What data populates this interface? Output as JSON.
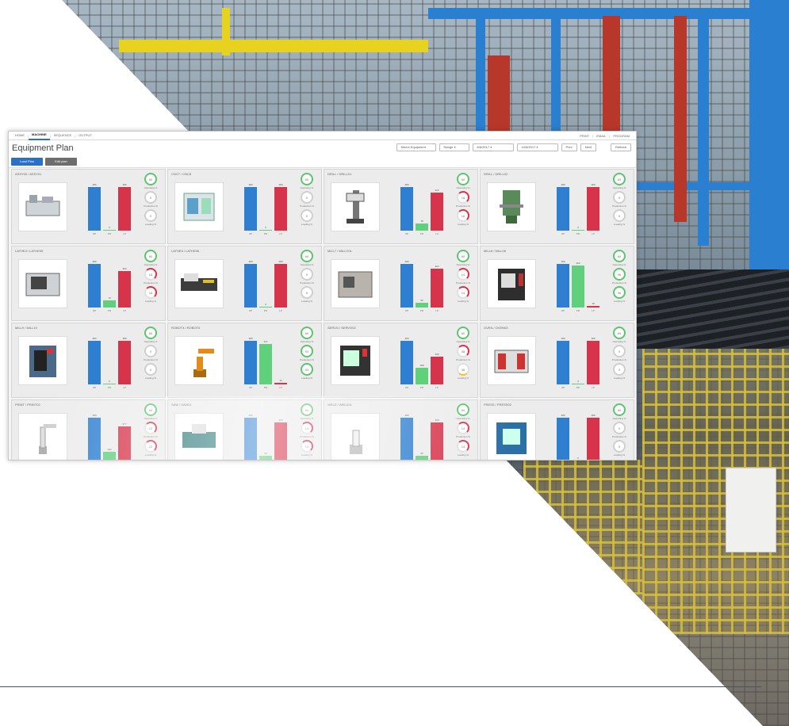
{
  "colors": {
    "accent": "#2a6fc9",
    "bar_blue": "#2e7fd2",
    "bar_green": "#5fd07b",
    "bar_red": "#d6344a",
    "ring_green": "#5fc36f"
  },
  "nav": {
    "tabs": [
      "HOME",
      "MACHINE",
      "SEQUENCE",
      "OUTPUT"
    ],
    "active_tab": "MACHINE",
    "right_links": [
      "PRINT",
      "EMAIL",
      "PROGRAM"
    ]
  },
  "header": {
    "title": "Equipment Plan",
    "select_equipment": "Select Equipment",
    "range_label": "Range",
    "date_from": "6/6/2017",
    "date_to": "10/6/2017",
    "prev_label": "Prev",
    "next_label": "Next",
    "refresh_label": "Refresh"
  },
  "actions": {
    "primary": "Load Plan",
    "secondary": "Edit plan"
  },
  "legend_labels": {
    "operating": "Operating %",
    "production": "Production %",
    "loading": "Loading %"
  },
  "axis_labels": [
    "OP",
    "PR",
    "LP"
  ],
  "cards": [
    {
      "title": "ASSY00 / ASSY01",
      "icon": "assembly-line-icon",
      "bars": [
        {
          "color": "blue",
          "value": "480",
          "h": 0.95
        },
        {
          "color": "green",
          "value": "0",
          "h": 0.02
        },
        {
          "color": "red",
          "value": "480",
          "h": 0.95
        }
      ],
      "rings": [
        "60",
        "0",
        "0"
      ],
      "ring_styles": [
        "g",
        "",
        ""
      ]
    },
    {
      "title": "CNC7 / CNC8",
      "icon": "printing-machine-icon",
      "bars": [
        {
          "color": "blue",
          "value": "480",
          "h": 0.95
        },
        {
          "color": "green",
          "value": "0",
          "h": 0.02
        },
        {
          "color": "red",
          "value": "480",
          "h": 0.95
        }
      ],
      "rings": [
        "60",
        "0",
        "0"
      ],
      "ring_styles": [
        "g",
        "",
        ""
      ]
    },
    {
      "title": "DRILL / DRILL01",
      "icon": "drill-press-icon",
      "bars": [
        {
          "color": "blue",
          "value": "480",
          "h": 0.95
        },
        {
          "color": "green",
          "value": "79",
          "h": 0.16
        },
        {
          "color": "red",
          "value": "416",
          "h": 0.82
        }
      ],
      "rings": [
        "60",
        "16",
        "16"
      ],
      "ring_styles": [
        "g",
        "r",
        "r"
      ]
    },
    {
      "title": "DRILL / DRILL02",
      "icon": "band-saw-icon",
      "bars": [
        {
          "color": "blue",
          "value": "480",
          "h": 0.95
        },
        {
          "color": "green",
          "value": "0",
          "h": 0.02
        },
        {
          "color": "red",
          "value": "480",
          "h": 0.95
        }
      ],
      "rings": [
        "60",
        "0",
        "0"
      ],
      "ring_styles": [
        "g",
        "",
        ""
      ]
    },
    {
      "title": "LATHE4 / LATHE05",
      "icon": "cnc-lathe-icon",
      "bars": [
        {
          "color": "blue",
          "value": "480",
          "h": 0.95
        },
        {
          "color": "green",
          "value": "76",
          "h": 0.15
        },
        {
          "color": "red",
          "value": "404",
          "h": 0.8
        }
      ],
      "rings": [
        "60",
        "16",
        "16"
      ],
      "ring_styles": [
        "g",
        "r",
        "r"
      ]
    },
    {
      "title": "LATHE5 / LATHE06",
      "icon": "injection-molder-icon",
      "bars": [
        {
          "color": "blue",
          "value": "480",
          "h": 0.95
        },
        {
          "color": "green",
          "value": "0",
          "h": 0.02
        },
        {
          "color": "red",
          "value": "480",
          "h": 0.95
        }
      ],
      "rings": [
        "60",
        "0",
        "0"
      ],
      "ring_styles": [
        "g",
        "",
        ""
      ]
    },
    {
      "title": "MILL7 / MILL07A",
      "icon": "cnc-mill-icon",
      "bars": [
        {
          "color": "blue",
          "value": "480",
          "h": 0.95
        },
        {
          "color": "green",
          "value": "56",
          "h": 0.11
        },
        {
          "color": "red",
          "value": "424",
          "h": 0.84
        }
      ],
      "rings": [
        "60",
        "14",
        "14"
      ],
      "ring_styles": [
        "g",
        "r",
        "r"
      ]
    },
    {
      "title": "MILL8 / MILL08",
      "icon": "machining-center-icon",
      "bars": [
        {
          "color": "blue",
          "value": "480",
          "h": 0.95
        },
        {
          "color": "green",
          "value": "462",
          "h": 0.92
        },
        {
          "color": "red",
          "value": "18",
          "h": 0.04
        }
      ],
      "rings": [
        "60",
        "96",
        "96"
      ],
      "ring_styles": [
        "g",
        "g",
        "g"
      ]
    },
    {
      "title": "MILL9 / MILL10",
      "icon": "vertical-mill-icon",
      "bars": [
        {
          "color": "blue",
          "value": "480",
          "h": 0.95
        },
        {
          "color": "green",
          "value": "0",
          "h": 0.02
        },
        {
          "color": "red",
          "value": "480",
          "h": 0.95
        }
      ],
      "rings": [
        "60",
        "0",
        "0"
      ],
      "ring_styles": [
        "g",
        "",
        ""
      ]
    },
    {
      "title": "ROBOT4 / ROBOT5",
      "icon": "industrial-robot-icon",
      "bars": [
        {
          "color": "blue",
          "value": "480",
          "h": 0.95
        },
        {
          "color": "green",
          "value": "447",
          "h": 0.88
        },
        {
          "color": "red",
          "value": "14",
          "h": 0.03
        }
      ],
      "rings": [
        "60",
        "93",
        "93"
      ],
      "ring_styles": [
        "g",
        "g",
        "g"
      ]
    },
    {
      "title": "SERVO / SERVO02",
      "icon": "turning-center-icon",
      "bars": [
        {
          "color": "blue",
          "value": "480",
          "h": 0.95
        },
        {
          "color": "green",
          "value": "180",
          "h": 0.36
        },
        {
          "color": "red",
          "value": "300",
          "h": 0.6
        }
      ],
      "rings": [
        "60",
        "38",
        "38"
      ],
      "ring_styles": [
        "g",
        "r",
        "y"
      ]
    },
    {
      "title": "OVEN / OVEN03",
      "icon": "furnace-icon",
      "bars": [
        {
          "color": "blue",
          "value": "480",
          "h": 0.95
        },
        {
          "color": "green",
          "value": "0",
          "h": 0.02
        },
        {
          "color": "red",
          "value": "480",
          "h": 0.95
        }
      ],
      "rings": [
        "60",
        "0",
        "0"
      ],
      "ring_styles": [
        "g",
        "",
        ""
      ]
    },
    {
      "title": "PRINT / PRINT02",
      "icon": "robot-arm-icon",
      "bars": [
        {
          "color": "blue",
          "value": "480",
          "h": 0.95
        },
        {
          "color": "green",
          "value": "104",
          "h": 0.21
        },
        {
          "color": "red",
          "value": "377",
          "h": 0.75
        }
      ],
      "rings": [
        "60",
        "22",
        "22"
      ],
      "ring_styles": [
        "g",
        "r",
        "r"
      ]
    },
    {
      "title": "SAW / SAW01",
      "icon": "router-table-icon",
      "bars": [
        {
          "color": "blue",
          "value": "480",
          "h": 0.95
        },
        {
          "color": "green",
          "value": "60",
          "h": 0.12
        },
        {
          "color": "red",
          "value": "420",
          "h": 0.84
        }
      ],
      "rings": [
        "60",
        "14",
        "14"
      ],
      "ring_styles": [
        "g",
        "r",
        "r"
      ]
    },
    {
      "title": "WELD / WELD01",
      "icon": "welding-robot-icon",
      "bars": [
        {
          "color": "blue",
          "value": "480",
          "h": 0.95
        },
        {
          "color": "green",
          "value": "60",
          "h": 0.12
        },
        {
          "color": "red",
          "value": "420",
          "h": 0.84
        }
      ],
      "rings": [
        "60",
        "14",
        "14"
      ],
      "ring_styles": [
        "g",
        "r",
        "r"
      ]
    },
    {
      "title": "PRESS / PRESS02",
      "icon": "press-machine-icon",
      "bars": [
        {
          "color": "blue",
          "value": "480",
          "h": 0.95
        },
        {
          "color": "green",
          "value": "0",
          "h": 0.02
        },
        {
          "color": "red",
          "value": "480",
          "h": 0.95
        }
      ],
      "rings": [
        "60",
        "0",
        "0"
      ],
      "ring_styles": [
        "g",
        "",
        ""
      ]
    }
  ]
}
